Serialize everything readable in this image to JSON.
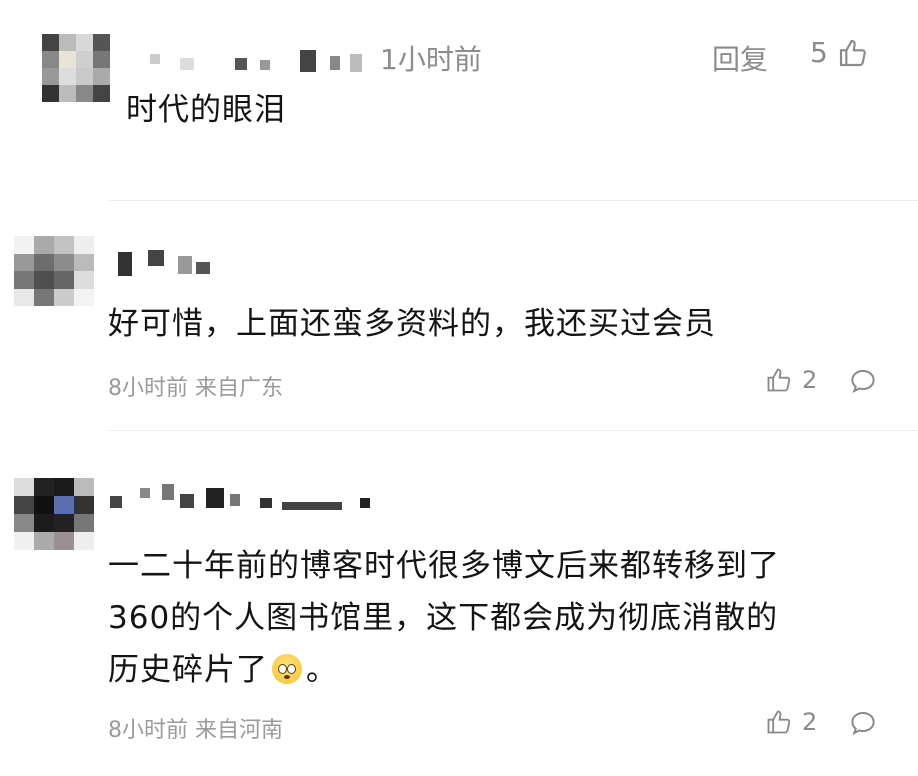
{
  "comments": [
    {
      "time": "1小时前",
      "reply_label": "回复",
      "likes": "5",
      "text": "时代的眼泪"
    },
    {
      "text": "好可惜，上面还蛮多资料的，我还买过会员",
      "meta": "8小时前 来自广东",
      "likes": "2"
    },
    {
      "text_line1": "一二十年前的博客时代很多博文后来都转移到了",
      "text_line2": "360的个人图书馆里，这下都会成为彻底消散的",
      "text_line3": "历史碎片了",
      "text_line3_end": "。",
      "meta": "8小时前 来自河南",
      "likes": "2"
    }
  ],
  "icons": {
    "like": "thumbs-up-icon",
    "comment": "comment-bubble-icon",
    "emoji": "flushed-face-emoji"
  }
}
